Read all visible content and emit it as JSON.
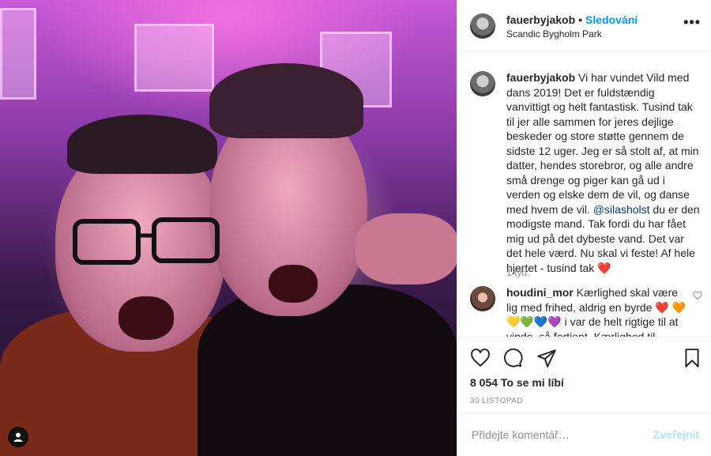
{
  "post": {
    "photo_alt": "Photo",
    "username": "fauerbyjakob",
    "separator": "•",
    "follow_label": "Sledování",
    "location": "Scandic Bygholm Park",
    "more_label": "•••"
  },
  "caption": {
    "username": "fauerbyjakob",
    "text_part1": "Vi har vundet Vild med dans 2019! Det er fuldstændig vanvittigt og helt fantastisk. Tusind tak til jer alle sammen for jeres dejlige beskeder og store støtte gennem de sidste 12 uger. Jeg er så stolt af, at min datter, hendes storebror, og alle andre små drenge og piger kan gå ud i verden og elske dem de vil, og danse med hvem de vil.",
    "mention": "@silasholst",
    "text_part2": "du er den modigste mand. Tak fordi du har fået mig ud på det dybeste vand. Det var det hele værd. Nu skal vi feste! Af hele hjertet - tusind tak",
    "heart": "❤️",
    "age": "1 týd."
  },
  "comment": {
    "username": "houdini_mor",
    "text": "Kærlighed skal være lig med frihed, aldrig en byrde ❤️ 🧡💛💚💙💜 i var de helt rigtige til at vinde, så fortjent. Kærlighed til",
    "like_icon": "heart-outline-icon"
  },
  "actions": {
    "like_icon": "heart-outline-icon",
    "comment_icon": "comment-icon",
    "share_icon": "share-icon",
    "save_icon": "bookmark-icon"
  },
  "likes_text": "8 054 To se mi líbí",
  "date": "30 LISTOPAD",
  "add_comment": {
    "placeholder": "Přidejte komentář…",
    "post_label": "Zveřejnit"
  },
  "colors": {
    "accent": "#0095f6",
    "post_disabled": "#b2dffc",
    "heart": "#ed4956"
  }
}
